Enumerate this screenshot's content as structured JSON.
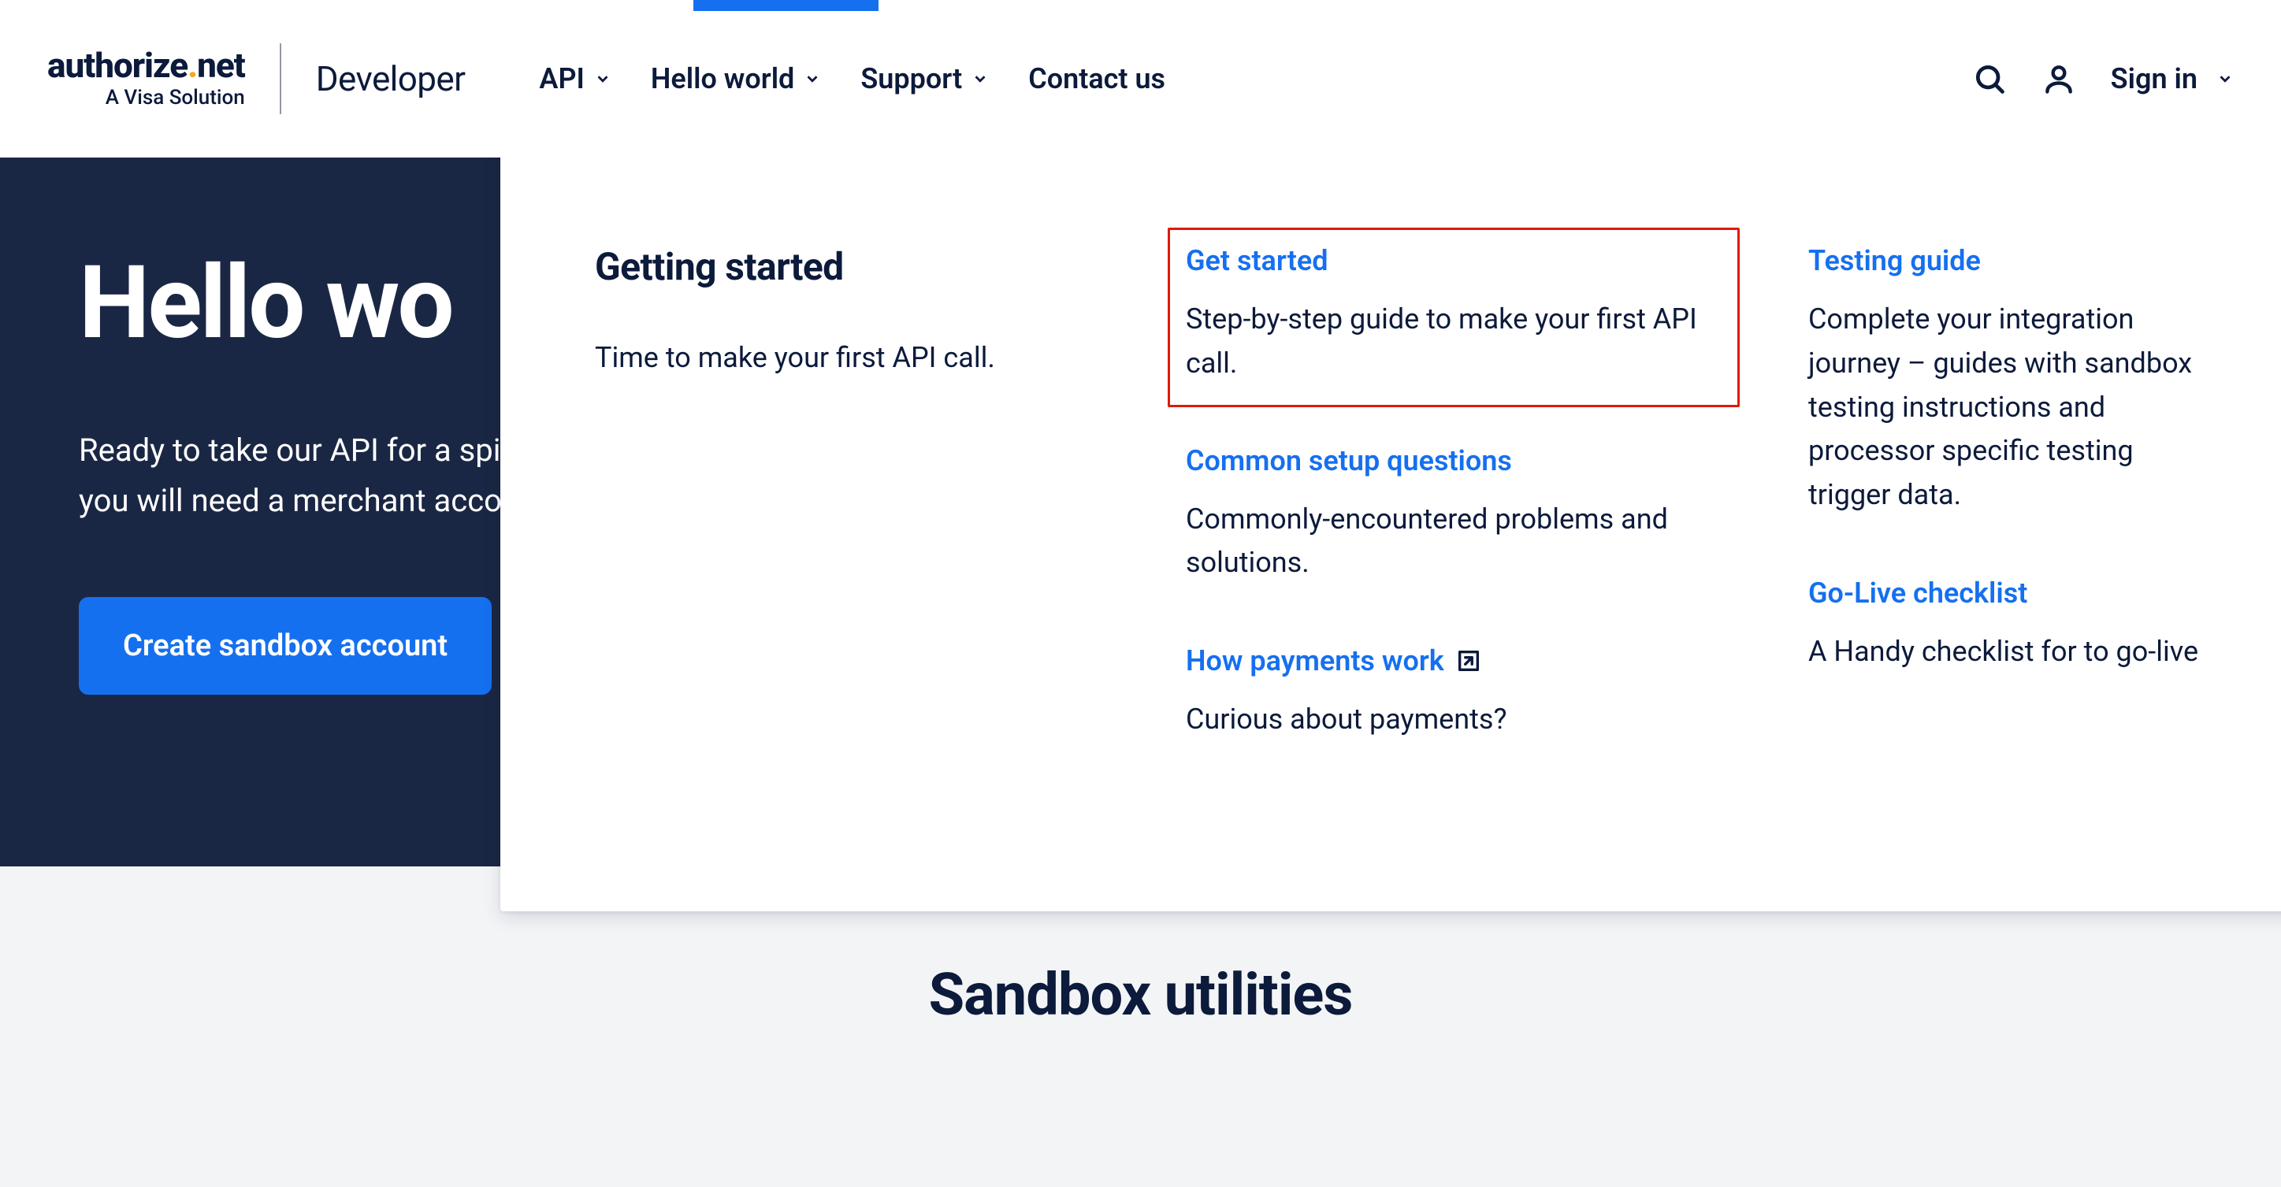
{
  "logo": {
    "word_prefix": "authorize",
    "word_suffix": "net",
    "tagline": "A Visa Solution"
  },
  "developer_label": "Developer",
  "nav": {
    "api": "API",
    "hello_world": "Hello world",
    "support": "Support",
    "contact": "Contact us"
  },
  "signin_label": "Sign in",
  "dropdown": {
    "heading": "Getting started",
    "heading_body": "Time to make your first API call.",
    "items": {
      "get_started": {
        "title": "Get started",
        "body": "Step-by-step guide to make your first API call."
      },
      "common_setup": {
        "title": "Common setup questions",
        "body": "Commonly-encountered problems and solutions."
      },
      "how_payments": {
        "title": "How payments work",
        "body": "Curious about payments?"
      },
      "testing_guide": {
        "title": "Testing guide",
        "body": "Complete your integration journey – guides with sandbox testing instructions and processor specific testing trigger data."
      },
      "go_live": {
        "title": "Go-Live checklist",
        "body": "A Handy checklist for to go-live"
      }
    }
  },
  "hero": {
    "title_visible": "Hello wo",
    "body": "Ready to take our API for a spin? Simply, create your account and go. To accept real payments, you will need a merchant account.",
    "cta": "Create sandbox account"
  },
  "sandbox": {
    "heading": "Sandbox utilities"
  }
}
